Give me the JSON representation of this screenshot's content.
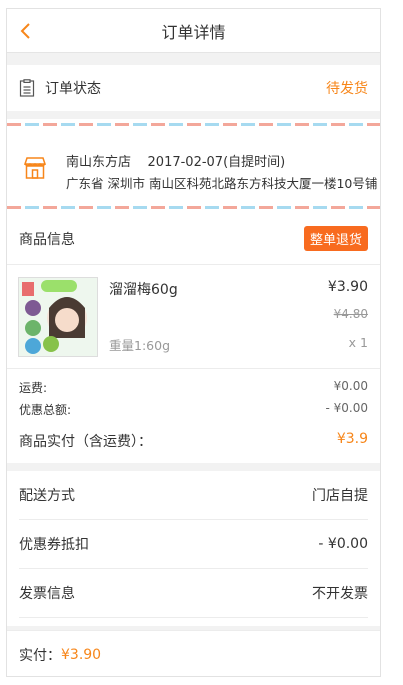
{
  "header": {
    "title": "订单详情",
    "back_icon": "chevron-left-icon",
    "accent": "#f7861a"
  },
  "status": {
    "label": "订单状态",
    "value": "待发货",
    "icon": "document-icon"
  },
  "store": {
    "name_line": "南山东方店    2017-02-07(自提时间)",
    "address": "广东省 深圳市 南山区科苑北路东方科技大厦一楼10号铺",
    "icon": "storefront-icon"
  },
  "goods": {
    "section_label": "商品信息",
    "refund_button": "整单退货",
    "product": {
      "name": "溜溜梅60g",
      "price": "¥3.90",
      "original_price": "¥4.80",
      "weight": "重量1:60g",
      "quantity": "x 1"
    },
    "shipping_label": "运费:",
    "shipping_value": "¥0.00",
    "discount_label": "优惠总额:",
    "discount_value": "- ¥0.00",
    "paid_label": "商品实付（含运费）：",
    "paid_value": "¥3.9"
  },
  "options": [
    {
      "label": "配送方式",
      "value": "门店自提"
    },
    {
      "label": "优惠券抵扣",
      "value": "- ¥0.00"
    },
    {
      "label": "发票信息",
      "value": "不开发票"
    }
  ],
  "footer": {
    "label": "实付：",
    "amount": "¥3.90"
  }
}
